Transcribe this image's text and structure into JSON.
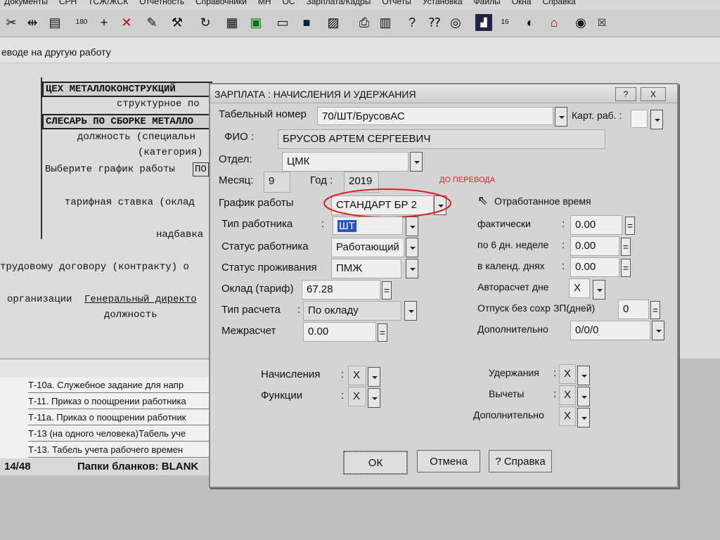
{
  "app": {
    "menu": [
      "Документы",
      "СРН",
      "ТСЖ/ЖСК",
      "Отчетность",
      "Справочники",
      "МН",
      "ОС",
      "Зарплата/Кадры",
      "Отчеты",
      "Установка",
      "Файлы",
      "Окна",
      "Справка"
    ],
    "subtitle": "еводе на другую работу",
    "doc": {
      "dept_box": "ЦЕХ МЕТАЛЛОКОНСТРУКЦИЙ",
      "struct_label": "структурное по",
      "position_box": "СЛЕСАРЬ ПО СБОРКЕ МЕТАЛЛО",
      "position_label": "должность (специальн",
      "category_label": "(категория)",
      "schedule_prompt": "Выберите график работы",
      "schedule_value": "ПО",
      "tariff_label": "тарифная ставка (оклад",
      "allowance_label": "надбавка",
      "contract_label": "трудовому договору (контракту) о",
      "org_label": "организации",
      "org_position": "Генеральный директо",
      "position_caption": "должность"
    },
    "list": [
      "Т-10а. Служебное задание для напр",
      "Т-11. Приказ о поощрении работника",
      "Т-11а. Приказ о поощрении работник",
      "Т-13 (на одного человека)Табель уче",
      "Т-13. Табель учета рабочего времен"
    ],
    "status": {
      "counter": "14/48",
      "folders": "Папки бланков: BLANK"
    }
  },
  "dialog": {
    "title": "ЗАРПЛАТА : НАЧИСЛЕНИЯ И УДЕРЖАНИЯ",
    "help_btn": "?",
    "close_btn": "X",
    "tab_num_label": "Табельный номер",
    "tab_num_value": "70/ШТ/БрусовАС",
    "card_label": "Карт. раб. :",
    "card_value": "",
    "fio_label": "ФИО :",
    "fio_value": "БРУСОВ АРТЕМ СЕРГЕЕВИЧ",
    "dept_label": "Отдел:",
    "dept_value": "ЦМК",
    "month_label": "Месяц:",
    "month_value": "9",
    "year_label": "Год :",
    "year_value": "2019",
    "annotation": "ДО ПЕРЕВОДА",
    "schedule_label": "График работы",
    "schedule_value": "СТАНДАРТ БР 2",
    "worker_type_label": "Тип работника",
    "worker_type_value": "ШТ",
    "worker_status_label": "Статус работника",
    "worker_status_value": "Работающий",
    "residence_label": "Статус проживания",
    "residence_value": "ПМЖ",
    "salary_label": "Оклад (тариф)",
    "salary_value": "67.28",
    "calc_type_label": "Тип расчета",
    "calc_type_value": "По окладу",
    "intercalc_label": "Межрасчет",
    "intercalc_value": "0.00",
    "worked_title": "Отработанное время",
    "actual_label": "фактически",
    "actual_value": "0.00",
    "six_day_label": "по 6 дн. неделе",
    "six_day_value": "0.00",
    "calendar_label": "в календ. днях",
    "calendar_value": "0.00",
    "autocalc_label": "Авторасчет дне",
    "autocalc_value": "X",
    "unpaid_label": "Отпуск без сохр ЗП(дней)",
    "unpaid_value": "0",
    "additional_label": "Дополнительно",
    "additional_value": "0/0/0",
    "accruals_label": "Начисления",
    "accruals_value": "X",
    "functions_label": "Функции",
    "functions_value": "X",
    "deductions_label": "Удержания",
    "deductions_value": "X",
    "withholdings_label": "Вычеты",
    "withholdings_value": "X",
    "additional2_label": "Дополнительно",
    "additional2_value": "X",
    "ok": "ОК",
    "cancel": "Отмена",
    "help": "? Справка",
    "colon": ":",
    "eq": "="
  }
}
